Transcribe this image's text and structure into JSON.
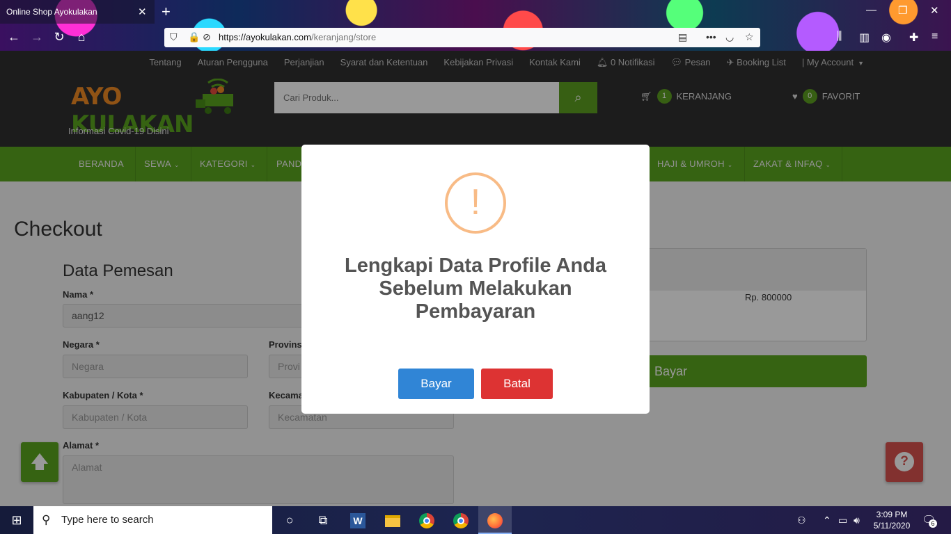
{
  "browser": {
    "tab_title": "Online Shop Ayokulakan",
    "url_host": "https://ayokulakan.com",
    "url_path": "/keranjang/store"
  },
  "site": {
    "top_links": [
      "Tentang",
      "Aturan Pengguna",
      "Perjanjian",
      "Syarat dan Ketentuan",
      "Kebijakan Privasi",
      "Kontak Kami"
    ],
    "notifications": "0 Notifikasi",
    "messages": "Pesan",
    "booking": "Booking List",
    "account": "| My Account",
    "logo_word1": "AYO",
    "logo_word2": "KULAKAN",
    "covid_info": "Informasi Covid-19 Disini",
    "search_placeholder": "Cari Produk...",
    "cart_count": "1",
    "cart_label": "KERANJANG",
    "fav_count": "0",
    "fav_label": "FAVORIT"
  },
  "nav": {
    "items": [
      "BERANDA",
      "SEWA",
      "KATEGORI",
      "PAND",
      "HAJI & UMROH",
      "ZAKAT & INFAQ"
    ]
  },
  "checkout": {
    "title": "Checkout",
    "section": "Data Pemesan",
    "nama_label": "Nama *",
    "nama_value": "aang12",
    "negara_label": "Negara *",
    "negara_placeholder": "Negara",
    "provinsi_label": "Provins",
    "provinsi_placeholder": "Provi",
    "kab_label": "Kabupaten / Kota *",
    "kab_placeholder": "Kabupaten / Kota",
    "kec_label": "Kecama",
    "kec_placeholder": "Kecamatan",
    "alamat_label": "Alamat *",
    "alamat_placeholder": "Alamat",
    "price": "Rp. 800000",
    "pay_label": "Bayar"
  },
  "modal": {
    "icon": "!",
    "title": "Lengkapi Data Profile Anda Sebelum Melakukan Pembayaran",
    "confirm": "Bayar",
    "cancel": "Batal",
    "colors": {
      "confirm": "#3085d6",
      "cancel": "#dd3333",
      "warning": "#f8bb86"
    }
  },
  "taskbar": {
    "search_placeholder": "Type here to search",
    "time": "3:09 PM",
    "date": "5/11/2020",
    "notif_count": "6"
  }
}
